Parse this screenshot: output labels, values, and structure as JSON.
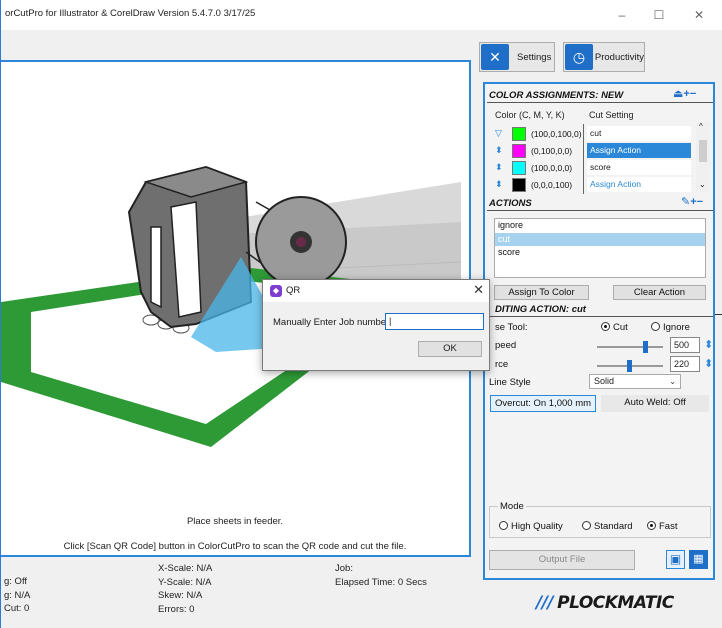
{
  "window": {
    "title": "orCutPro for Illustrator & CorelDraw Version 5.4.7.0 3/17/25",
    "minimize": "–",
    "maximize": "☐",
    "close": "✕"
  },
  "preview": {
    "line1": "Place sheets in feeder.",
    "line2": "Click [Scan QR Code] button in ColorCutPro to scan the QR code and cut the file."
  },
  "status": {
    "col1": [
      "g: Off",
      "g:  N/A",
      "Cut: 0"
    ],
    "col2": [
      "X-Scale: N/A",
      "Y-Scale: N/A",
      "Skew: N/A",
      "Errors: 0"
    ],
    "col3": [
      "Job:",
      "Elapsed Time:  0 Secs"
    ]
  },
  "toolbar": {
    "settings_label": "Settings",
    "productivity_label": "Productivity"
  },
  "color_assignments": {
    "title": "COLOR ASSIGNMENTS: NEW",
    "col_color": "Color (C, M, Y, K)",
    "col_cut": "Cut Setting",
    "rows": [
      {
        "swatch": "#00ff00",
        "cmyk": "(100,0,100,0)",
        "cut": "cut",
        "state": "normal",
        "arrow": "▽"
      },
      {
        "swatch": "#ff00ff",
        "cmyk": "(0,100,0,0)",
        "cut": "Assign Action",
        "state": "selected",
        "arrow": "⬍"
      },
      {
        "swatch": "#00ffff",
        "cmyk": "(100,0,0,0)",
        "cut": "score",
        "state": "normal",
        "arrow": "⬍"
      },
      {
        "swatch": "#000000",
        "cmyk": "(0,0,0,100)",
        "cut": "Assign Action",
        "state": "blue",
        "arrow": "⬍"
      }
    ]
  },
  "actions": {
    "title": "ACTIONS",
    "items": [
      "ignore",
      "cut",
      "score"
    ],
    "selected_index": 1,
    "assign_label": "Assign To Color",
    "clear_label": "Clear Action"
  },
  "editing": {
    "title": "DITING ACTION: cut",
    "use_tool_label": "se Tool:",
    "tool_cut": "Cut",
    "tool_ignore": "Ignore",
    "speed_label": "peed",
    "speed_value": "500",
    "speed_fraction": 0.7,
    "force_label": "rce",
    "force_value": "220",
    "force_fraction": 0.45,
    "line_style_label": "Line Style",
    "line_style_value": "Solid",
    "overcut_label": "Overcut: On 1,000 mm",
    "autoweld_label": "Auto Weld: Off"
  },
  "mode": {
    "title": "Mode",
    "options": [
      "High Quality",
      "Standard",
      "Fast"
    ],
    "selected": "Fast"
  },
  "output_label": "Output File",
  "dialog": {
    "title": "QR",
    "prompt": "Manually Enter Job number",
    "input_value": "|",
    "ok_label": "OK",
    "close": "✕"
  },
  "brand": {
    "slashes": "///",
    "name": "PLOCKMATIC"
  },
  "colors": {
    "accent": "#2b87d8",
    "selection": "#2b87d8",
    "floor_green": "#2e9a36"
  }
}
